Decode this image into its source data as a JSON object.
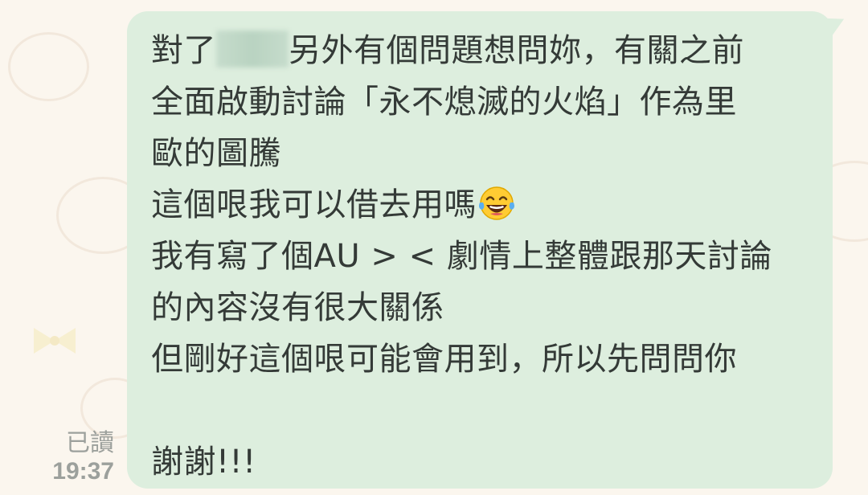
{
  "message": {
    "line1_before": "對了",
    "line1_after": "另外有個問題想問妳，有關之前",
    "line2": "全面啟動討論「永不熄滅的火焰」作為里",
    "line3": "歐的圖騰",
    "line4": "這個哏我可以借去用嗎",
    "line4_emoji": "face-with-tears-of-joy-emoji",
    "line5": "我有寫了個AU > < 劇情上整體跟那天討論",
    "line6": "的內容沒有很大關係",
    "line7": "但剛好這個哏可能會用到，所以先問問你",
    "line8": "",
    "line9": "謝謝!!!"
  },
  "meta": {
    "read_status": "已讀",
    "time": "19:37"
  },
  "colors": {
    "bubble": "#ddeede",
    "text": "#343a37",
    "meta_text": "#9ca09c",
    "background": "#fbf6ee"
  }
}
